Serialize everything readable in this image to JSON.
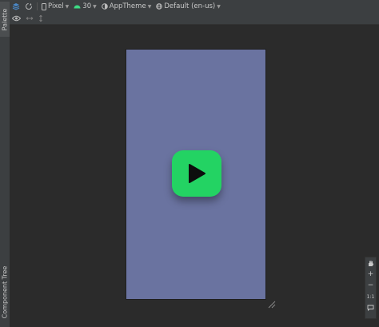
{
  "toolbar": {
    "device": "Pixel",
    "api": "30",
    "theme": "AppTheme",
    "locale": "Default (en-us)"
  },
  "left_rail": {
    "palette": "Palette",
    "component_tree": "Component Tree"
  },
  "zoom": {
    "zoom_in": "+",
    "zoom_out": "−",
    "actual_size": "1:1"
  },
  "colors": {
    "canvas_bg": "#2b2b2b",
    "toolbar_bg": "#3c3f41",
    "device_bg": "#6a73a0",
    "app_icon_bg": "#23d363",
    "api_icon": "#3ddc84"
  }
}
